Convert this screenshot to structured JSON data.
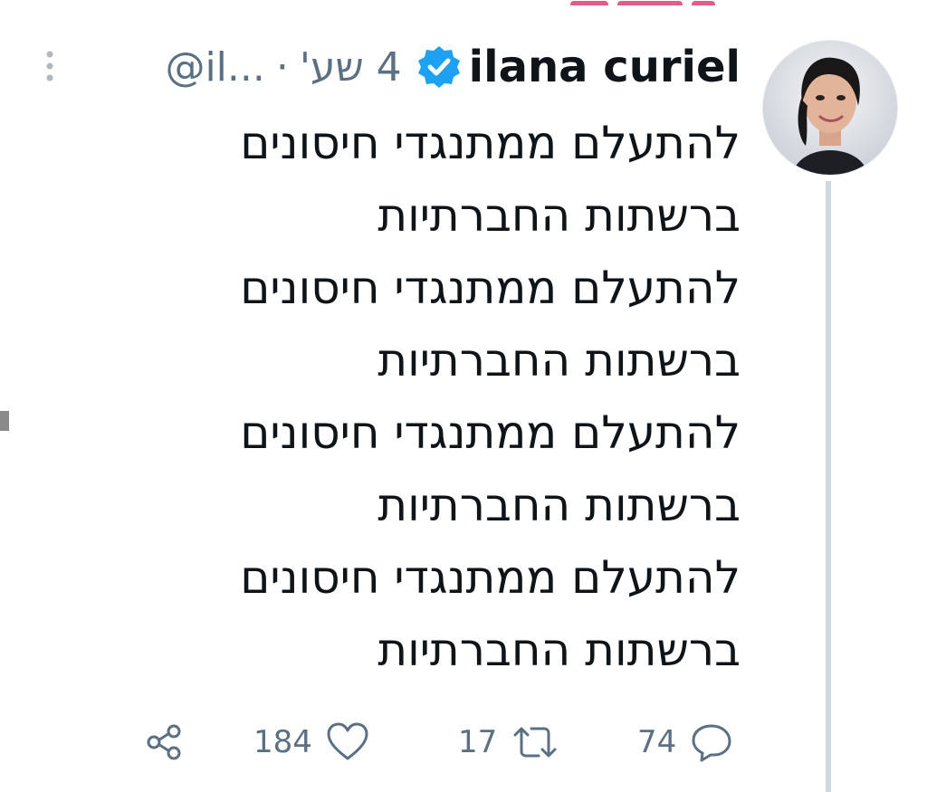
{
  "tweet": {
    "author": {
      "display_name": "ilana curiel",
      "handle": "@il...",
      "verified_icon": "verified-badge-icon"
    },
    "separator": "·",
    "timestamp": "4 שע'",
    "lines": [
      "להתעלם ממתנגדי חיסונים",
      "ברשתות החברתיות",
      "להתעלם ממתנגדי חיסונים",
      "ברשתות החברתיות",
      "להתעלם ממתנגדי חיסונים",
      "ברשתות החברתיות",
      "להתעלם ממתנגדי חיסונים",
      "ברשתות החברתיות"
    ],
    "actions": {
      "share_icon": "share-icon",
      "likes": "184",
      "retweets": "17",
      "replies": "74"
    }
  },
  "colors": {
    "text": "#0f1419",
    "secondary": "#5b7083",
    "verified": "#1da1f2",
    "thread_line": "#cfd9de"
  }
}
